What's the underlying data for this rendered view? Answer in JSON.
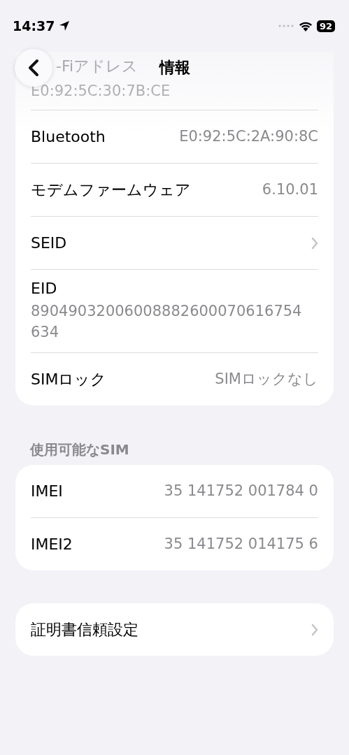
{
  "status_bar": {
    "time": "14:37",
    "battery": "92"
  },
  "nav": {
    "title": "情報"
  },
  "groups": [
    {
      "rows": [
        {
          "kind": "partial",
          "label": "-Fiアドレス",
          "value": "E0:92:5C:30:7B:CE"
        },
        {
          "kind": "detail",
          "label": "Bluetooth",
          "value": "E0:92:5C:2A:90:8C"
        },
        {
          "kind": "detail",
          "label": "モデムファームウェア",
          "value": "6.10.01"
        },
        {
          "kind": "link",
          "label": "SEID"
        },
        {
          "kind": "stacked",
          "label": "EID",
          "value": "89049032006008882600070616754634"
        },
        {
          "kind": "detail",
          "label": "SIMロック",
          "value": "SIMロックなし"
        }
      ]
    },
    {
      "header": "使用可能なSIM",
      "rows": [
        {
          "kind": "detail",
          "label": "IMEI",
          "value": "35 141752 001784 0"
        },
        {
          "kind": "detail",
          "label": "IMEI2",
          "value": "35 141752 014175 6"
        }
      ]
    },
    {
      "rows": [
        {
          "kind": "link",
          "label": "証明書信頼設定"
        }
      ]
    }
  ]
}
